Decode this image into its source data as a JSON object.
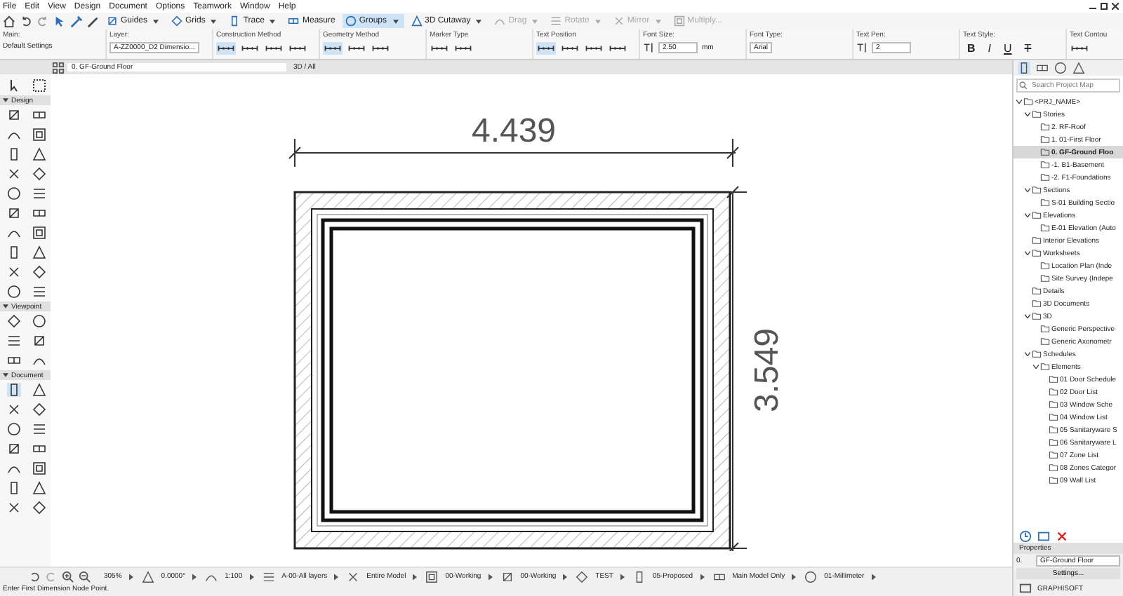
{
  "menu": [
    "File",
    "Edit",
    "View",
    "Design",
    "Document",
    "Options",
    "Teamwork",
    "Window",
    "Help"
  ],
  "toolbar": [
    {
      "label": "Guides",
      "dropdown": true,
      "selected": false,
      "disabled": false
    },
    {
      "label": "Grids",
      "dropdown": true,
      "selected": false,
      "disabled": false
    },
    {
      "label": "Trace",
      "dropdown": true,
      "selected": false,
      "disabled": false
    },
    {
      "label": "Measure",
      "dropdown": false,
      "selected": false,
      "disabled": false
    },
    {
      "label": "Groups",
      "dropdown": true,
      "selected": true,
      "disabled": false
    },
    {
      "label": "3D Cutaway",
      "dropdown": true,
      "selected": false,
      "disabled": false
    },
    {
      "label": "Drag",
      "dropdown": true,
      "selected": false,
      "disabled": true
    },
    {
      "label": "Rotate",
      "dropdown": true,
      "selected": false,
      "disabled": true
    },
    {
      "label": "Mirror",
      "dropdown": true,
      "selected": false,
      "disabled": true
    },
    {
      "label": "Multiply...",
      "dropdown": false,
      "selected": false,
      "disabled": true
    }
  ],
  "infobox": [
    {
      "kind": "text",
      "label": "Main:",
      "value": "Default Settings"
    },
    {
      "kind": "dropdown",
      "label": "Layer:",
      "value": "A-ZZ0000_D2 Dimensio..."
    },
    {
      "kind": "options",
      "label": "Construction Method",
      "options": [
        {
          "selected": true
        },
        {
          "selected": false
        },
        {
          "selected": false
        },
        {
          "selected": false
        }
      ]
    },
    {
      "kind": "options",
      "label": "Geometry Method",
      "options": [
        {
          "selected": true
        },
        {
          "selected": false
        },
        {
          "selected": false
        }
      ]
    },
    {
      "kind": "options",
      "label": "Marker Type",
      "options": [
        {
          "selected": false
        },
        {
          "selected": false
        }
      ]
    },
    {
      "kind": "options",
      "label": "Text Position",
      "options": [
        {
          "selected": true
        },
        {
          "selected": false
        },
        {
          "selected": false
        },
        {
          "selected": false
        }
      ]
    },
    {
      "kind": "field",
      "label": "Font Size:",
      "value": "2.50",
      "unit": "mm"
    },
    {
      "kind": "dropdown",
      "label": "Font Type:",
      "value": "Arial"
    },
    {
      "kind": "field",
      "label": "Text Pen:",
      "value": "2"
    },
    {
      "kind": "styles",
      "label": "Text Style:",
      "buttons": [
        "B",
        "I",
        "U",
        "T"
      ]
    },
    {
      "kind": "options",
      "label": "Text Contou",
      "options": [
        {
          "selected": false
        }
      ]
    }
  ],
  "tabs": [
    {
      "label": "0. GF-Ground Floor",
      "selected": true
    },
    {
      "label": "3D / All",
      "selected": false
    }
  ],
  "toolbox": {
    "top": [
      {
        "selected": false
      },
      {
        "selected": false
      }
    ],
    "sections": [
      {
        "title": "Design",
        "expanded": true,
        "tools": [
          {
            "selected": false
          },
          {
            "selected": false
          },
          {
            "selected": false
          },
          {
            "selected": false
          },
          {
            "selected": false
          },
          {
            "selected": false
          },
          {
            "selected": false
          },
          {
            "selected": false
          },
          {
            "selected": false
          },
          {
            "selected": false
          },
          {
            "selected": false
          },
          {
            "selected": false
          },
          {
            "selected": false
          },
          {
            "selected": false
          },
          {
            "selected": false
          },
          {
            "selected": false
          },
          {
            "selected": false
          },
          {
            "selected": false
          },
          {
            "selected": false
          },
          {
            "selected": false
          }
        ]
      },
      {
        "title": "Viewpoint",
        "expanded": true,
        "tools": [
          {
            "selected": false
          },
          {
            "selected": false
          },
          {
            "selected": false
          },
          {
            "selected": false
          },
          {
            "selected": false
          },
          {
            "selected": false
          }
        ]
      },
      {
        "title": "Document",
        "expanded": true,
        "tools": [
          {
            "selected": true
          },
          {
            "selected": false
          },
          {
            "selected": false
          },
          {
            "selected": false
          },
          {
            "selected": false
          },
          {
            "selected": false
          },
          {
            "selected": false
          },
          {
            "selected": false
          },
          {
            "selected": false
          },
          {
            "selected": false
          },
          {
            "selected": false
          },
          {
            "selected": false
          },
          {
            "selected": false
          },
          {
            "selected": false
          }
        ]
      }
    ]
  },
  "canvas": {
    "width_dimension": "4.439",
    "height_dimension": "3.549"
  },
  "navigator": {
    "tabs": [
      {
        "selected": true
      },
      {
        "selected": false
      },
      {
        "selected": false
      },
      {
        "selected": false
      }
    ],
    "search": {
      "placeholder": "Search Project Map"
    },
    "tree": [
      {
        "label": "<PRJ_NAME>",
        "selected": false,
        "expanded": true,
        "children": [
          {
            "label": "Stories",
            "selected": false,
            "expanded": true,
            "children": [
              {
                "label": "2. RF-Roof",
                "selected": false
              },
              {
                "label": "1. 01-First Floor",
                "selected": false
              },
              {
                "label": "0. GF-Ground Floo",
                "selected": true
              },
              {
                "label": "-1. B1-Basement",
                "selected": false
              },
              {
                "label": "-2. F1-Foundations",
                "selected": false
              }
            ]
          },
          {
            "label": "Sections",
            "selected": false,
            "expanded": true,
            "children": [
              {
                "label": "S-01 Building Sectio",
                "selected": false
              }
            ]
          },
          {
            "label": "Elevations",
            "selected": false,
            "expanded": true,
            "children": [
              {
                "label": "E-01 Elevation (Auto",
                "selected": false
              }
            ]
          },
          {
            "label": "Interior Elevations",
            "selected": false
          },
          {
            "label": "Worksheets",
            "selected": false,
            "expanded": true,
            "children": [
              {
                "label": "Location Plan (Inde",
                "selected": false
              },
              {
                "label": "Site Survey (Indepe",
                "selected": false
              }
            ]
          },
          {
            "label": "Details",
            "selected": false
          },
          {
            "label": "3D Documents",
            "selected": false
          },
          {
            "label": "3D",
            "selected": false,
            "expanded": true,
            "children": [
              {
                "label": "Generic Perspective",
                "selected": false
              },
              {
                "label": "Generic Axonometr",
                "selected": false
              }
            ]
          },
          {
            "label": "Schedules",
            "selected": false,
            "expanded": true,
            "children": [
              {
                "label": "Elements",
                "selected": false,
                "expanded": true,
                "children": [
                  {
                    "label": "01 Door Schedule",
                    "selected": false
                  },
                  {
                    "label": "02 Door List",
                    "selected": false
                  },
                  {
                    "label": "03 Window Sche",
                    "selected": false
                  },
                  {
                    "label": "04 Window List",
                    "selected": false
                  },
                  {
                    "label": "05 Sanitaryware S",
                    "selected": false
                  },
                  {
                    "label": "06 Sanitaryware L",
                    "selected": false
                  },
                  {
                    "label": "07 Zone List",
                    "selected": false
                  },
                  {
                    "label": "08 Zones Categor",
                    "selected": false
                  },
                  {
                    "label": "09 Wall List",
                    "selected": false
                  }
                ]
              }
            ]
          }
        ]
      }
    ],
    "properties": {
      "title": "Properties",
      "id": "0.",
      "name": "GF-Ground Floor",
      "button": "Settings..."
    },
    "brand": "GRAPHISOFT"
  },
  "status_bar": {
    "fields": [
      "305%",
      "0.0000°",
      "1:100",
      "A-00-All layers",
      "Entire Model",
      "00-Working",
      "00-Working",
      "TEST",
      "05-Proposed",
      "Main Model Only",
      "01-Millimeter"
    ],
    "message": "Enter First Dimension Node Point."
  }
}
